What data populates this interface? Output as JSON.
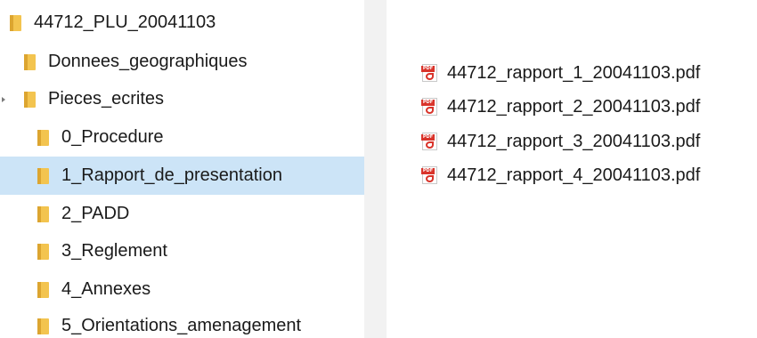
{
  "tree": {
    "items": [
      {
        "label": "44712_PLU_20041103",
        "selected": false,
        "chevron": false
      },
      {
        "label": "Donnees_geographiques",
        "selected": false,
        "chevron": false
      },
      {
        "label": "Pieces_ecrites",
        "selected": false,
        "chevron": true
      },
      {
        "label": "0_Procedure",
        "selected": false,
        "chevron": false
      },
      {
        "label": "1_Rapport_de_presentation",
        "selected": true,
        "chevron": false
      },
      {
        "label": "2_PADD",
        "selected": false,
        "chevron": false
      },
      {
        "label": "3_Reglement",
        "selected": false,
        "chevron": false
      },
      {
        "label": "4_Annexes",
        "selected": false,
        "chevron": false
      },
      {
        "label": "5_Orientations_amenagement",
        "selected": false,
        "chevron": false
      }
    ]
  },
  "files": {
    "icon": "pdf-file-icon",
    "icon_tag": "PDF",
    "items": [
      {
        "name": "44712_rapport_1_20041103.pdf"
      },
      {
        "name": "44712_rapport_2_20041103.pdf"
      },
      {
        "name": "44712_rapport_3_20041103.pdf"
      },
      {
        "name": "44712_rapport_4_20041103.pdf"
      }
    ]
  },
  "colors": {
    "selection": "#cce4f7",
    "folder": "#f3c44f",
    "pdf_red": "#d9342b",
    "divider": "#f2f2f2"
  }
}
